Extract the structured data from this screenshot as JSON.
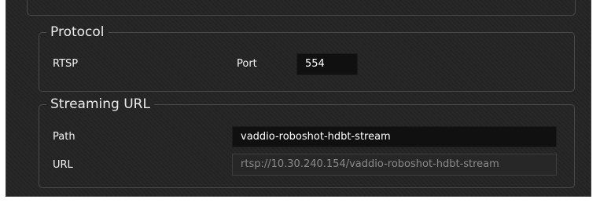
{
  "protocol": {
    "legend": "Protocol",
    "type_label": "RTSP",
    "port_label": "Port",
    "port_value": "554"
  },
  "streaming": {
    "legend": "Streaming URL",
    "path_label": "Path",
    "path_value": "vaddio-roboshot-hdbt-stream",
    "url_label": "URL",
    "url_value": "rtsp://10.30.240.154/vaddio-roboshot-hdbt-stream"
  }
}
